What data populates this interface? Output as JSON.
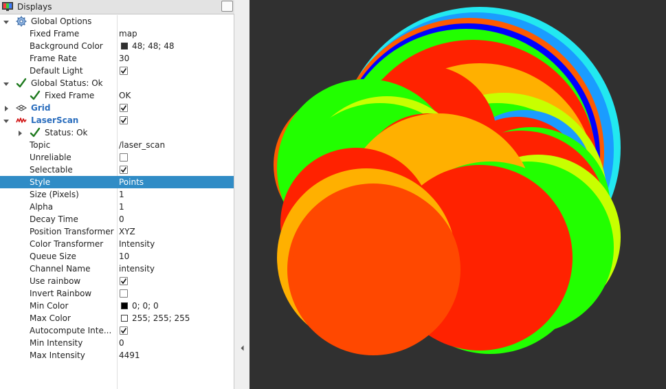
{
  "panel": {
    "title": "Displays"
  },
  "rows": [
    {
      "key": "global_options",
      "name": "Global Options",
      "indent": 1,
      "expander": "open",
      "icon": "gear"
    },
    {
      "key": "fixed_frame",
      "name": "Fixed Frame",
      "value": "map",
      "indent": 2
    },
    {
      "key": "background_color",
      "name": "Background Color",
      "value": "48; 48; 48",
      "swatch": "#303030",
      "indent": 2
    },
    {
      "key": "frame_rate",
      "name": "Frame Rate",
      "value": "30",
      "indent": 2
    },
    {
      "key": "default_light",
      "name": "Default Light",
      "check": true,
      "indent": 2
    },
    {
      "key": "global_status",
      "name": "Global Status: Ok",
      "indent": 1,
      "expander": "open",
      "icon": "check"
    },
    {
      "key": "status_fixed_frame",
      "name": "Fixed Frame",
      "value": "OK",
      "indent": 2,
      "icon": "check"
    },
    {
      "key": "grid",
      "name": "Grid",
      "indent": 1,
      "expander": "closed",
      "icon": "grid",
      "bold": true,
      "check": true
    },
    {
      "key": "laserscan",
      "name": "LaserScan",
      "indent": 1,
      "expander": "open",
      "icon": "laser",
      "bold": true,
      "check": true
    },
    {
      "key": "laser_status",
      "name": "Status: Ok",
      "indent": 2,
      "expander": "closed",
      "icon": "check"
    },
    {
      "key": "topic",
      "name": "Topic",
      "value": "/laser_scan",
      "indent": 2
    },
    {
      "key": "unreliable",
      "name": "Unreliable",
      "check": false,
      "indent": 2
    },
    {
      "key": "selectable",
      "name": "Selectable",
      "check": true,
      "indent": 2
    },
    {
      "key": "style",
      "name": "Style",
      "value": "Points",
      "indent": 2,
      "selected": true
    },
    {
      "key": "size_pixels",
      "name": "Size (Pixels)",
      "value": "1",
      "indent": 2
    },
    {
      "key": "alpha",
      "name": "Alpha",
      "value": "1",
      "indent": 2
    },
    {
      "key": "decay_time",
      "name": "Decay Time",
      "value": "0",
      "indent": 2
    },
    {
      "key": "position_transformer",
      "name": "Position Transformer",
      "value": "XYZ",
      "indent": 2
    },
    {
      "key": "color_transformer",
      "name": "Color Transformer",
      "value": "Intensity",
      "indent": 2
    },
    {
      "key": "queue_size",
      "name": "Queue Size",
      "value": "10",
      "indent": 2
    },
    {
      "key": "channel_name",
      "name": "Channel Name",
      "value": "intensity",
      "indent": 2
    },
    {
      "key": "use_rainbow",
      "name": "Use rainbow",
      "check": true,
      "indent": 2
    },
    {
      "key": "invert_rainbow",
      "name": "Invert Rainbow",
      "check": false,
      "indent": 2
    },
    {
      "key": "min_color",
      "name": "Min Color",
      "value": "0; 0; 0",
      "swatch": "#000000",
      "indent": 2
    },
    {
      "key": "max_color",
      "name": "Max Color",
      "value": "255; 255; 255",
      "swatch": "#ffffff",
      "indent": 2
    },
    {
      "key": "autocompute_intensity",
      "name": "Autocompute Inte...",
      "check": true,
      "indent": 2
    },
    {
      "key": "min_intensity",
      "name": "Min Intensity",
      "value": "0",
      "indent": 2
    },
    {
      "key": "max_intensity",
      "name": "Max Intensity",
      "value": "4491",
      "indent": 2
    }
  ],
  "viewport": {
    "background": "#303030",
    "rings": [
      {
        "color": "#22e8f0"
      },
      {
        "color": "#1a9cff"
      },
      {
        "color": "#ff5a00"
      },
      {
        "color": "#0000ff"
      },
      {
        "color": "#ff2200"
      },
      {
        "color": "#ffb000"
      },
      {
        "color": "#c8ff00"
      },
      {
        "color": "#22ff00"
      },
      {
        "color": "#1a9cff"
      },
      {
        "color": "#ff2200"
      },
      {
        "color": "#22ff00"
      },
      {
        "color": "#ff5a00"
      },
      {
        "color": "#ff2200"
      },
      {
        "color": "#22ff00"
      },
      {
        "color": "#c8ff00"
      },
      {
        "color": "#22ff00"
      },
      {
        "color": "#ff2200"
      },
      {
        "color": "#ffb000"
      },
      {
        "color": "#22ff00"
      },
      {
        "color": "#ff2200"
      },
      {
        "color": "#ffb000"
      },
      {
        "color": "#22ff00"
      },
      {
        "color": "#ff2200"
      },
      {
        "color": "#ff4800"
      }
    ]
  }
}
